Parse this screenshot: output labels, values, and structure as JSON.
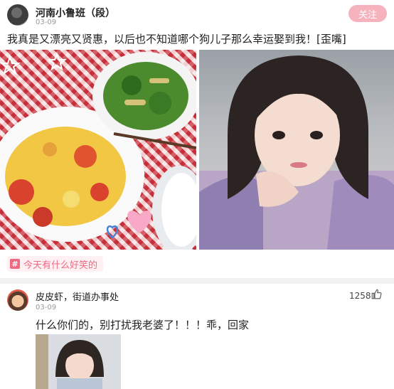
{
  "post": {
    "author": "河南小鲁班（段）",
    "date": "03-09",
    "follow_label": "关注",
    "text": "我真是又漂亮又贤惠，以后也不知道哪个狗儿子那么幸运娶到我！[歪嘴]",
    "tag_icon": "#",
    "tag": "今天有什么好笑的"
  },
  "comment": {
    "author": "皮皮虾，街道办事处",
    "date": "03-09",
    "likes": "1258",
    "text": "什么你们的，别打扰我老婆了！！！乖，回家"
  },
  "colors": {
    "accent": "#ee6a82",
    "follow_bg": "#f6b3be"
  },
  "icons": {
    "like": "thumb-up-icon",
    "topic": "hash-icon"
  }
}
